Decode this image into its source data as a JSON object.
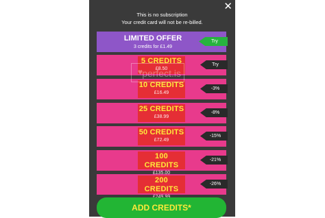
{
  "dialog": {
    "close_symbol": "✕",
    "notice_line1": "This is no subscription",
    "notice_line2": "Your credit card will not be re-billed."
  },
  "limited_offer": {
    "title": "LIMITED OFFER",
    "subtitle": "3 credits for £1.49",
    "tag": "Try"
  },
  "packages": [
    {
      "name": "5 CREDITS",
      "price": "£8.50",
      "tag": "Try"
    },
    {
      "name": "10 CREDITS",
      "price": "£16.49",
      "tag": "-3%"
    },
    {
      "name": "25 CREDITS",
      "price": "£38.99",
      "tag": "-8%"
    },
    {
      "name": "50 CREDITS",
      "price": "£72.49",
      "tag": "-15%"
    },
    {
      "name": "100 CREDITS",
      "price": "£135.00",
      "tag": "-21%"
    },
    {
      "name": "200 CREDITS",
      "price": "£249.99",
      "tag": "-26%"
    }
  ],
  "add_button": "ADD CREDITS*",
  "watermark": "perfect.is",
  "colors": {
    "panel": "#3a3a3a",
    "row_pink": "#e83a8c",
    "limited_purple": "#8e56c8",
    "credit_box_red": "#e52e35",
    "credit_text_yellow": "#ffe93b",
    "tag_dark": "#2a2a2a",
    "tag_green": "#27b33f",
    "button_green": "#22b534"
  }
}
